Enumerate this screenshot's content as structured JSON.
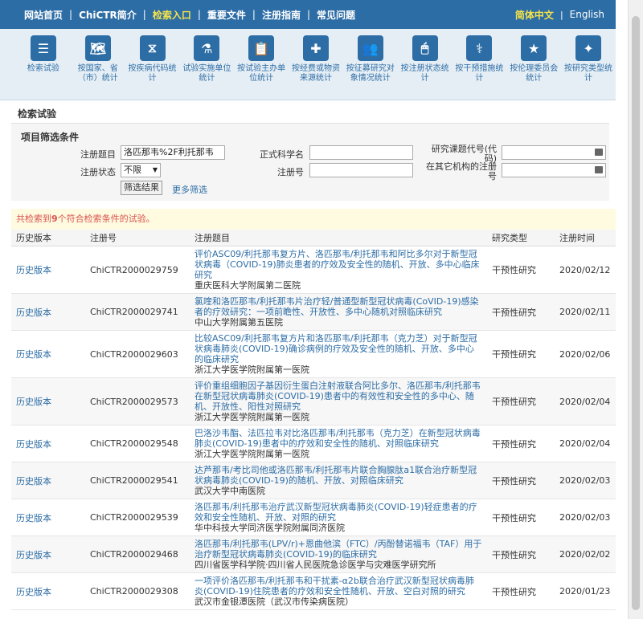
{
  "nav": {
    "items": [
      {
        "label": "网站首页",
        "active": false
      },
      {
        "label": "ChiCTR简介",
        "active": false
      },
      {
        "label": "检索入口",
        "active": true
      },
      {
        "label": "重要文件",
        "active": false
      },
      {
        "label": "注册指南",
        "active": false
      },
      {
        "label": "常见问题",
        "active": false
      }
    ],
    "lang_cn": "简体中文",
    "lang_sep": "|",
    "lang_en": "English"
  },
  "iconbar": [
    {
      "icon": "list-numbered-icon",
      "glyph": "☰",
      "label": "检索试验"
    },
    {
      "icon": "world-map-icon",
      "glyph": "🗺",
      "label": "按国家、省（市）统计"
    },
    {
      "icon": "dna-icon",
      "glyph": "⧖",
      "label": "按疾病代码统计"
    },
    {
      "icon": "flask-icon",
      "glyph": "⚗",
      "label": "试验实施单位统计"
    },
    {
      "icon": "clipboard-icon",
      "glyph": "📋",
      "label": "按试验主办单位统计"
    },
    {
      "icon": "medical-kit-icon",
      "glyph": "✚",
      "label": "按经费或物资来源统计"
    },
    {
      "icon": "people-icon",
      "glyph": "👥",
      "label": "按征募研究对象情况统计"
    },
    {
      "icon": "mouse-icon",
      "glyph": "🖱",
      "label": "按注册状态统计"
    },
    {
      "icon": "doctor-icon",
      "glyph": "⚕",
      "label": "按干预措施统计"
    },
    {
      "icon": "star-icon",
      "glyph": "★",
      "label": "按伦理委员会统计"
    },
    {
      "icon": "sparkle-icon",
      "glyph": "✦",
      "label": "按研究类型统计"
    }
  ],
  "page_title": "检索试验",
  "filter": {
    "title": "项目筛选条件",
    "reg_title_label": "注册题目",
    "reg_title_value": "洛匹那韦%2F利托那韦",
    "reg_status_label": "注册状态",
    "reg_status_value": "不限",
    "sci_name_label": "正式科学名",
    "sci_name_value": "",
    "reg_no_label": "注册号",
    "reg_no_value": "",
    "code_label": "研究课题代号(代码)",
    "other_reg_label": "在其它机构的注册号",
    "search_button": "筛选结果",
    "more_link": "更多筛选"
  },
  "notice": {
    "prefix": "共检索到",
    "count": "9",
    "suffix": "个符合检索条件的试验。"
  },
  "table": {
    "headers": [
      "历史版本",
      "注册号",
      "注册题目",
      "研究类型",
      "注册时间"
    ],
    "rows": [
      {
        "hist": "历史版本",
        "reg": "ChiCTR2000029759",
        "title": "评价ASC09/利托那韦复方片、洛匹那韦/利托那韦和阿比多尔对于新型冠状病毒（COVID-19)肺炎患者的疗效及安全性的随机、开放、多中心临床研究",
        "org": "重庆医科大学附属第二医院",
        "type": "干预性研究",
        "date": "2020/02/12"
      },
      {
        "hist": "历史版本",
        "reg": "ChiCTR2000029741",
        "title": "氯喹和洛匹那韦/利托那韦片治疗轻/普通型新型冠状病毒(CoVID-19)感染者的疗效研究：一项前瞻性、开放性、多中心随机对照临床研究",
        "org": "中山大学附属第五医院",
        "type": "干预性研究",
        "date": "2020/02/11"
      },
      {
        "hist": "历史版本",
        "reg": "ChiCTR2000029603",
        "title": "比较ASC09/利托那韦复方片和洛匹那韦/利托那韦（克力芝）对于新型冠状病毒肺炎(COVID-19)确诊病例的疗效及安全性的随机、开放、多中心的临床研究",
        "org": "浙江大学医学院附属第一医院",
        "type": "干预性研究",
        "date": "2020/02/06"
      },
      {
        "hist": "历史版本",
        "reg": "ChiCTR2000029573",
        "title": "评价重组细胞因子基因衍生蛋白注射液联合阿比多尔、洛匹那韦/利托那韦在新型冠状病毒肺炎(COVID-19)患者中的有效性和安全性的多中心、随机、开放性、阳性对照研究",
        "org": "浙江大学医学院附属第一医院",
        "type": "干预性研究",
        "date": "2020/02/04"
      },
      {
        "hist": "历史版本",
        "reg": "ChiCTR2000029548",
        "title": "巴洛沙韦酯、法匹拉韦对比洛匹那韦/利托那韦（克力芝）在新型冠状病毒肺炎(COVID-19)患者中的疗效和安全性的随机、对照临床研究",
        "org": "浙江大学医学院附属第一医院",
        "type": "干预性研究",
        "date": "2020/02/04"
      },
      {
        "hist": "历史版本",
        "reg": "ChiCTR2000029541",
        "title": "达芦那韦/考比司他或洛匹那韦/利托那韦片联合胸腺肽a1联合治疗新型冠状病毒肺炎(COVID-19)的随机、开放、对照临床研究",
        "org": "武汉大学中南医院",
        "type": "干预性研究",
        "date": "2020/02/03"
      },
      {
        "hist": "历史版本",
        "reg": "ChiCTR2000029539",
        "title": "洛匹那韦/利托那韦治疗武汉新型冠状病毒肺炎(COVID-19)轻症患者的疗效和安全性随机、开放、对照的研究",
        "org": "华中科技大学同济医学院附属同济医院",
        "type": "干预性研究",
        "date": "2020/02/03"
      },
      {
        "hist": "历史版本",
        "reg": "ChiCTR2000029468",
        "title": "洛匹那韦/利托那韦(LPV/r)+恩曲他滨（FTC）/丙酚替诺福韦（TAF）用于治疗新型冠状病毒肺炎(COVID-19)的临床研究",
        "org": "四川省医学科学院·四川省人民医院急诊医学与灾难医学研究所",
        "type": "干预性研究",
        "date": "2020/02/02"
      },
      {
        "hist": "历史版本",
        "reg": "ChiCTR2000029308",
        "title": "一项评价洛匹那韦/利托那韦和干扰素-α2b联合治疗武汉新型冠状病毒肺炎(COVID-19)住院患者的疗效和安全性随机、开放、空白对照的研究",
        "org": "武汉市金银潭医院（武汉市传染病医院）",
        "type": "干预性研究",
        "date": "2020/01/23"
      }
    ]
  }
}
